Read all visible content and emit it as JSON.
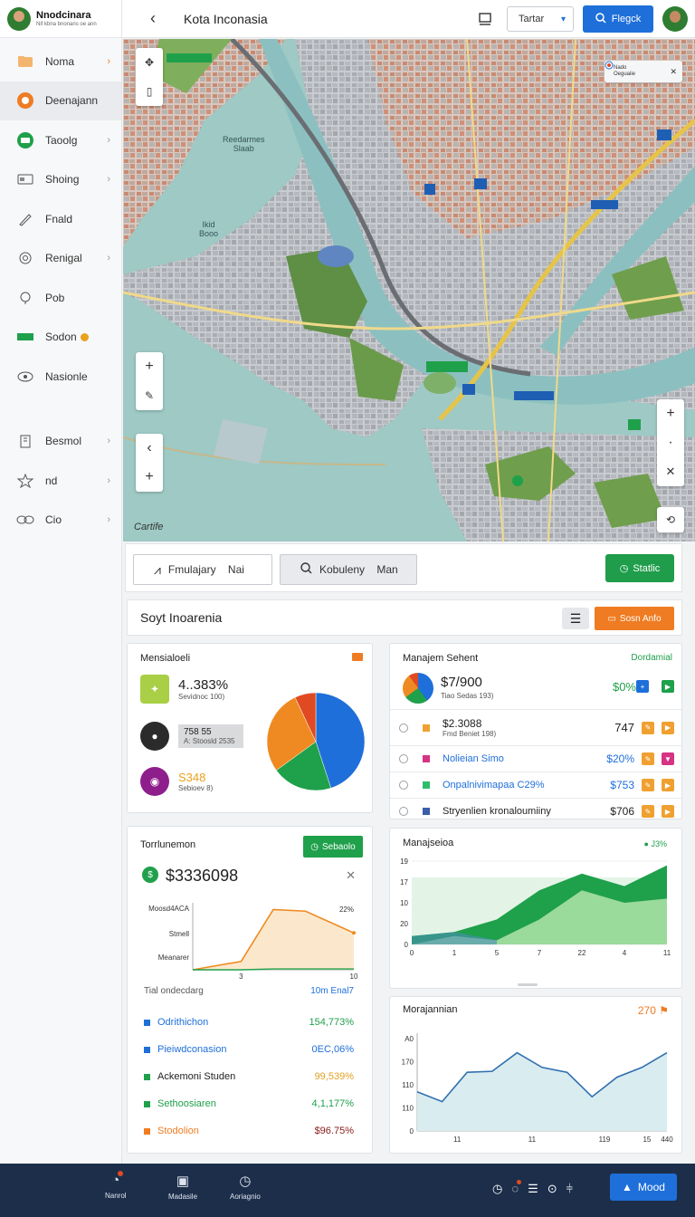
{
  "brand": {
    "name": "Nnodcinara",
    "subtitle": "Nif kbna bnonans oe ann"
  },
  "sidebar": {
    "items": [
      {
        "label": "Noma",
        "icon": "folder-icon",
        "chevron": true
      },
      {
        "label": "Deenajann",
        "icon": "circle-icon",
        "active": true
      },
      {
        "label": "Taoolg",
        "icon": "chat-icon",
        "chevron": true
      },
      {
        "label": "Shoing",
        "icon": "card-icon",
        "chevron": true
      },
      {
        "label": "Fnald",
        "icon": "pen-icon"
      },
      {
        "label": "Renigal",
        "icon": "target-icon",
        "chevron": true
      },
      {
        "label": "Pob",
        "icon": "pin-icon"
      },
      {
        "label": "Sodon",
        "icon": "truck-icon"
      },
      {
        "label": "Nasionle",
        "icon": "eye-icon"
      }
    ],
    "items2": [
      {
        "label": "Besmol",
        "icon": "building-icon",
        "chevron": true
      },
      {
        "label": "nd",
        "icon": "star-icon",
        "chevron": true
      },
      {
        "label": "Cio",
        "icon": "link-icon",
        "chevron": true
      }
    ]
  },
  "topbar": {
    "title": "Kota Inconasia",
    "select_label": "Tartar",
    "primary_label": "Flegck"
  },
  "map": {
    "labels": [
      "Reedarmes\nSlaab",
      "Ikid\nBooo"
    ],
    "card_label": "Nado\nOeguaiie",
    "attribution": "Cartife"
  },
  "search": {
    "input1": "Fmulajary    Nai",
    "input2": "Kobuleny    Man",
    "button": "Statlic"
  },
  "section": {
    "title": "Soyt Inoarenia",
    "button": "Sosn Anfo"
  },
  "card_a": {
    "title": "Mensialoeli",
    "stats": [
      {
        "value": "4..383%",
        "sub": "Sevidnoc 100)",
        "color": "#a8cf45",
        "icon": "sprout-icon"
      },
      {
        "value": "758 55",
        "sub": "A: Stoosld 2535",
        "color": "#2b2b2b",
        "icon": "person-icon"
      },
      {
        "value": "S348",
        "sub": "Sebioev 8)",
        "color": "#8e1e8c",
        "icon": "user-circle-icon"
      }
    ],
    "colors": {
      "blue": "#1e6fd9",
      "green": "#1fa04b",
      "orange": "#ef8a22",
      "red": "#e04a22"
    },
    "pie_values": [
      45,
      20,
      28,
      7
    ]
  },
  "card_b": {
    "title": "Manajem Sehent",
    "link": "Dordamial",
    "top_value": "$7/900",
    "top_sub": "Tiao Sedas 193)",
    "top_right": "$0%",
    "rows": [
      {
        "label": "$2.3088",
        "sub": "Fmd Beniet 198)",
        "value": "747",
        "color": "#f0a030",
        "value_color": "#222"
      },
      {
        "label": "Nolieian Simo",
        "value": "$20%",
        "color": "#d63384",
        "value_color": "#1e6fd9",
        "label_color": "#1e6fd9"
      },
      {
        "label": "Onpalnivimapaa C29%",
        "value": "$753",
        "color": "#2ebd6b",
        "value_color": "#1e6fd9",
        "label_color": "#1e6fd9"
      },
      {
        "label": "Stryenlien kronaloumiiny",
        "value": "$706",
        "color": "#3a5ea8",
        "value_color": "#222",
        "label_color": "#222"
      }
    ]
  },
  "card_c": {
    "title": "Torrlunemon",
    "button": "Sebaolo",
    "big_value": "$3336098",
    "y_labels": [
      "Moosd4ACA",
      "Stmell",
      "Meanarer"
    ],
    "x_ticks": [
      "3",
      "10"
    ],
    "pct": "22%",
    "footer_left": "Tial ondecdarg",
    "footer_right": "10m Enal7",
    "rows": [
      {
        "label": "Odrithichon",
        "value": "154,773%",
        "color": "#1e6fd9",
        "label_color": "#1e6fd9",
        "value_color": "#1fa04b"
      },
      {
        "label": "Pieiwdconasion",
        "value": "0EC,06%",
        "color": "#1e6fd9",
        "label_color": "#1e6fd9",
        "value_color": "#1e6fd9"
      },
      {
        "label": "Ackemoni Studen",
        "value": "99,539%",
        "color": "#1fa04b",
        "label_color": "#222",
        "value_color": "#e0a020"
      },
      {
        "label": "Sethoosiaren",
        "value": "4,1,177%",
        "color": "#1fa04b",
        "label_color": "#1fa04b",
        "value_color": "#1fa04b"
      },
      {
        "label": "Stodolion",
        "value": "$96.75%",
        "color": "#ef7c23",
        "label_color": "#ef7c23",
        "value_color": "#8b1a1a"
      }
    ]
  },
  "card_d": {
    "title": "Manajseioa",
    "badge": "● J3%",
    "y_ticks": [
      "19",
      "17",
      "10",
      "20",
      "0"
    ],
    "x_ticks": [
      "0",
      "1",
      "5",
      "7",
      "22",
      "4",
      "11"
    ]
  },
  "card_e": {
    "title": "Morajannian",
    "badge": "270",
    "y_ticks": [
      "A0",
      "170",
      "110",
      "110",
      "0"
    ],
    "x_ticks": [
      "11",
      "11",
      "119",
      "15",
      "440"
    ]
  },
  "chart_data": [
    {
      "type": "line",
      "x": [
        0,
        3,
        5,
        7,
        10
      ],
      "series": [
        {
          "values": [
            0,
            0.5,
            3.6,
            3.5,
            2.2
          ]
        },
        {
          "values": [
            0,
            0,
            0.05,
            0.05,
            0.05
          ]
        }
      ]
    },
    {
      "type": "area",
      "x": [
        0,
        1,
        5,
        7,
        22,
        4,
        11
      ],
      "series": [
        {
          "values": [
            2,
            3,
            6,
            13,
            17,
            14,
            19
          ]
        },
        {
          "values": [
            0,
            2,
            1,
            6,
            13,
            10,
            11
          ]
        }
      ]
    },
    {
      "type": "line",
      "x": [
        0,
        1,
        2,
        3,
        4,
        5,
        6,
        7,
        8,
        9,
        10
      ],
      "values": [
        80,
        60,
        120,
        122,
        160,
        130,
        120,
        70,
        110,
        130,
        160
      ]
    }
  ],
  "bottombar": {
    "items": [
      {
        "label": "Nanrol",
        "icon": "gauge-icon"
      },
      {
        "label": "Madasile",
        "icon": "image-icon"
      },
      {
        "label": "Aoriagnio",
        "icon": "clock-icon"
      }
    ],
    "button": "Mood"
  }
}
